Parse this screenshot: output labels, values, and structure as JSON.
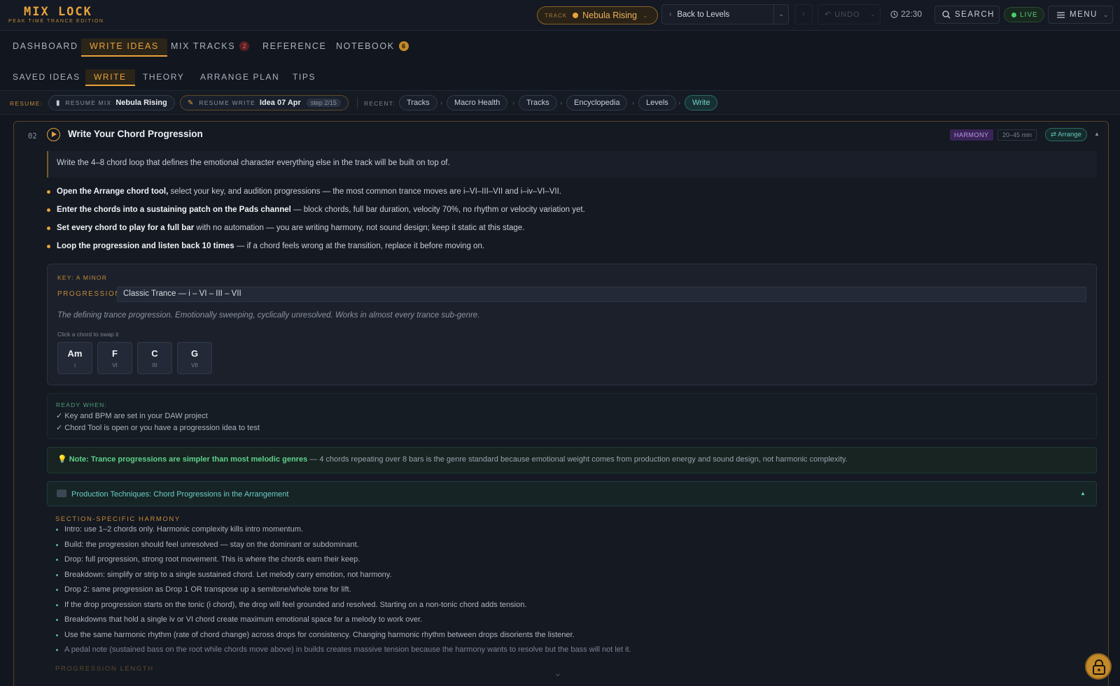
{
  "logo": {
    "name": "MIX LOCK",
    "subtitle": "PEAK TIME TRANCE EDITION"
  },
  "topbar": {
    "track_label": "TRACK",
    "track_value": "Nebula Rising",
    "back_label": "Back to Levels",
    "undo_label": "UNDO",
    "time": "22:30",
    "search_label": "SEARCH",
    "live_label": "LIVE",
    "menu_label": "MENU"
  },
  "main_tabs": [
    {
      "label": "DASHBOARD"
    },
    {
      "label": "WRITE IDEAS"
    },
    {
      "label": "MIX TRACKS",
      "badge": "2"
    },
    {
      "label": "REFERENCE"
    },
    {
      "label": "NOTEBOOK",
      "badge": "6"
    }
  ],
  "sub_tabs": [
    {
      "label": "SAVED IDEAS"
    },
    {
      "label": "WRITE"
    },
    {
      "label": "THEORY"
    },
    {
      "label": "ARRANGE PLAN"
    },
    {
      "label": "TIPS"
    }
  ],
  "resume": {
    "label": "RESUME:",
    "mix": {
      "small": "RESUME MIX",
      "value": "Nebula Rising"
    },
    "write": {
      "small": "RESUME WRITE",
      "value": "Idea 07 Apr",
      "step": "step 2/15"
    },
    "recent_label": "RECENT:",
    "recent": [
      "Tracks",
      "Macro Health",
      "Tracks",
      "Encyclopedia",
      "Levels",
      "Write"
    ]
  },
  "card": {
    "number": "02",
    "title": "Write Your Chord Progression",
    "tag": "HARMONY",
    "duration": "20–45 min",
    "arrange_link": "⇄ Arrange",
    "intro": "Write the 4–8 chord loop that defines the emotional character everything else in the track will be built on top of.",
    "steps": [
      {
        "bold": "Open the Arrange chord tool,",
        "text": " select your key, and audition progressions — the most common trance moves are i–VI–III–VII and i–iv–VI–VII."
      },
      {
        "bold": "Enter the chords into a sustaining patch on the Pads channel",
        "text": " — block chords, full bar duration, velocity 70%, no rhythm or velocity variation yet."
      },
      {
        "bold": "Set every chord to play for a full bar",
        "text": " with no automation — you are writing harmony, not sound design; keep it static at this stage."
      },
      {
        "bold": "Loop the progression and listen back 10 times",
        "text": " — if a chord feels wrong at the transition, replace it before moving on."
      }
    ],
    "progression": {
      "key_label": "KEY: A MINOR",
      "label": "PROGRESSION",
      "selected": "Classic Trance — i – VI – III – VII",
      "description": "The defining trance progression. Emotionally sweeping, cyclically unresolved. Works in almost every trance sub-genre.",
      "hint": "Click a chord to swap it",
      "chords": [
        {
          "name": "Am",
          "roman": "i"
        },
        {
          "name": "F",
          "roman": "VI"
        },
        {
          "name": "C",
          "roman": "III"
        },
        {
          "name": "G",
          "roman": "VII"
        }
      ]
    },
    "ready": {
      "label": "READY WHEN:",
      "items": [
        "✓ Key and BPM are set in your DAW project",
        "✓ Chord Tool is open or you have a progression idea to test"
      ]
    },
    "note": {
      "highlight": "Note: Trance progressions are simpler than most melodic genres",
      "text": " — 4 chords repeating over 8 bars is the genre standard because emotional weight comes from production energy and sound design, not harmonic complexity."
    },
    "production": {
      "title": "Production Techniques: Chord Progressions in the Arrangement"
    },
    "section_label": "SECTION-SPECIFIC HARMONY",
    "harmony_items": [
      "Intro: use 1–2 chords only. Harmonic complexity kills intro momentum.",
      "Build: the progression should feel unresolved — stay on the dominant or subdominant.",
      "Drop: full progression, strong root movement. This is where the chords earn their keep.",
      "Breakdown: simplify or strip to a single sustained chord. Let melody carry emotion, not harmony.",
      "Drop 2: same progression as Drop 1 OR transpose up a semitone/whole tone for lift.",
      "If the drop progression starts on the tonic (i chord), the drop will feel grounded and resolved. Starting on a non-tonic chord adds tension.",
      "Breakdowns that hold a single iv or VI chord create maximum emotional space for a melody to work over.",
      "Use the same harmonic rhythm (rate of chord change) across drops for consistency. Changing harmonic rhythm between drops disorients the listener.",
      "A pedal note (sustained bass on the root while chords move above) in builds creates massive tension because the harmony wants to resolve but the bass will not let it."
    ],
    "next_section_label": "PROGRESSION LENGTH"
  },
  "colors": {
    "accent": "#e8a33a",
    "teal": "#4fb8b0",
    "green": "#5fd08a",
    "purple": "#3a2457"
  }
}
